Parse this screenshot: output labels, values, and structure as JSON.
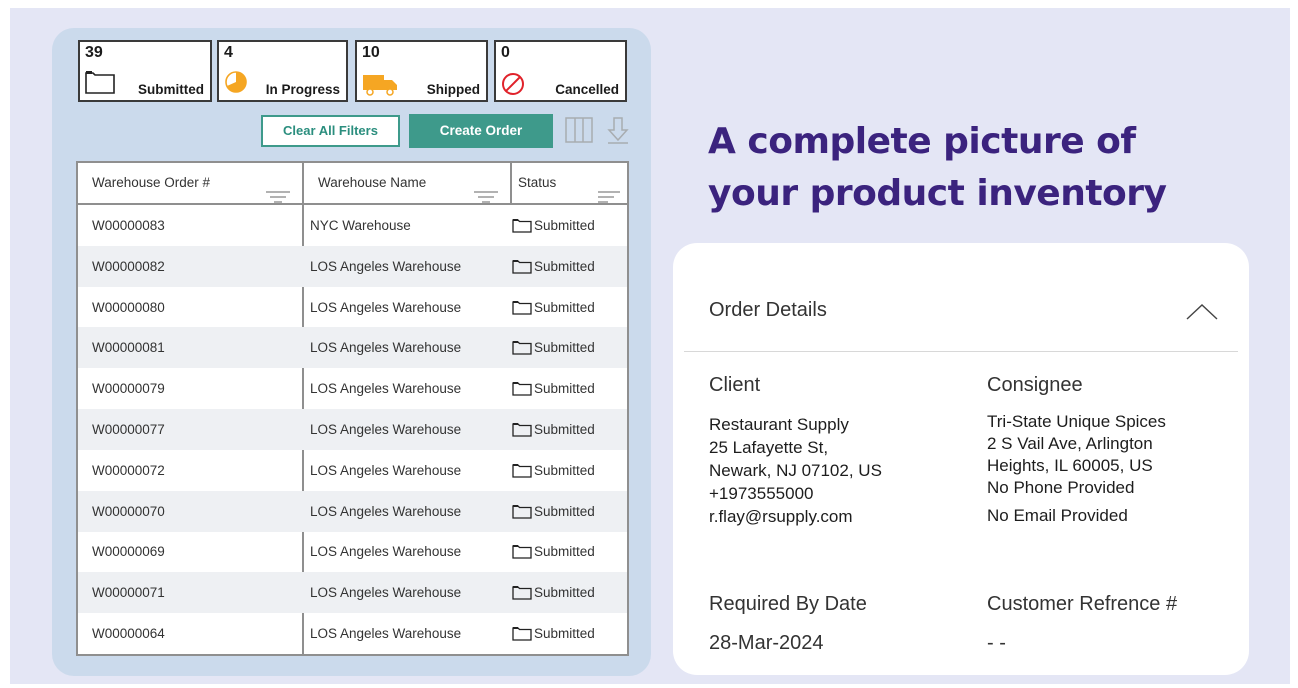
{
  "stats": [
    {
      "count": "39",
      "label": "Submitted",
      "icon": "folder-icon"
    },
    {
      "count": "4",
      "label": "In Progress",
      "icon": "progress-pie-icon"
    },
    {
      "count": "10",
      "label": "Shipped",
      "icon": "truck-icon"
    },
    {
      "count": "0",
      "label": "Cancelled",
      "icon": "cancel-icon"
    }
  ],
  "toolbar": {
    "clear_label": "Clear All Filters",
    "create_label": "Create Order"
  },
  "table": {
    "headers": [
      "Warehouse Order #",
      "Warehouse Name",
      "Status"
    ],
    "rows": [
      {
        "order": "W00000083",
        "warehouse": "NYC Warehouse",
        "status": "Submitted"
      },
      {
        "order": "W00000082",
        "warehouse": "LOS Angeles Warehouse",
        "status": "Submitted"
      },
      {
        "order": "W00000080",
        "warehouse": "LOS Angeles Warehouse",
        "status": "Submitted"
      },
      {
        "order": "W00000081",
        "warehouse": "LOS Angeles Warehouse",
        "status": "Submitted"
      },
      {
        "order": "W00000079",
        "warehouse": "LOS Angeles Warehouse",
        "status": "Submitted"
      },
      {
        "order": "W00000077",
        "warehouse": "LOS Angeles Warehouse",
        "status": "Submitted"
      },
      {
        "order": "W00000072",
        "warehouse": "LOS Angeles Warehouse",
        "status": "Submitted"
      },
      {
        "order": "W00000070",
        "warehouse": "LOS Angeles Warehouse",
        "status": "Submitted"
      },
      {
        "order": "W00000069",
        "warehouse": "LOS Angeles Warehouse",
        "status": "Submitted"
      },
      {
        "order": "W00000071",
        "warehouse": "LOS Angeles Warehouse",
        "status": "Submitted"
      },
      {
        "order": "W00000064",
        "warehouse": "LOS Angeles Warehouse",
        "status": "Submitted"
      }
    ]
  },
  "headline": {
    "line1": "A complete picture of",
    "line2": "your product inventory"
  },
  "details": {
    "title": "Order Details",
    "client_label": "Client",
    "client_lines": [
      "Restaurant Supply",
      "25 Lafayette St,",
      "Newark, NJ 07102, US",
      "+1973555000",
      "r.flay@rsupply.com"
    ],
    "consignee_label": "Consignee",
    "consignee_lines": [
      "Tri-State Unique Spices",
      "2 S Vail Ave, Arlington",
      "Heights, IL 60005, US",
      "No Phone Provided",
      "No Email Provided"
    ],
    "required_label": "Required By Date",
    "required_value": "28-Mar-2024",
    "reference_label": "Customer Refrence #",
    "reference_value": "- -"
  },
  "colors": {
    "accent": "#3e9a8b",
    "headline": "#3b237e",
    "panel": "#cbdaec",
    "page_bg": "#e4e6f5"
  }
}
